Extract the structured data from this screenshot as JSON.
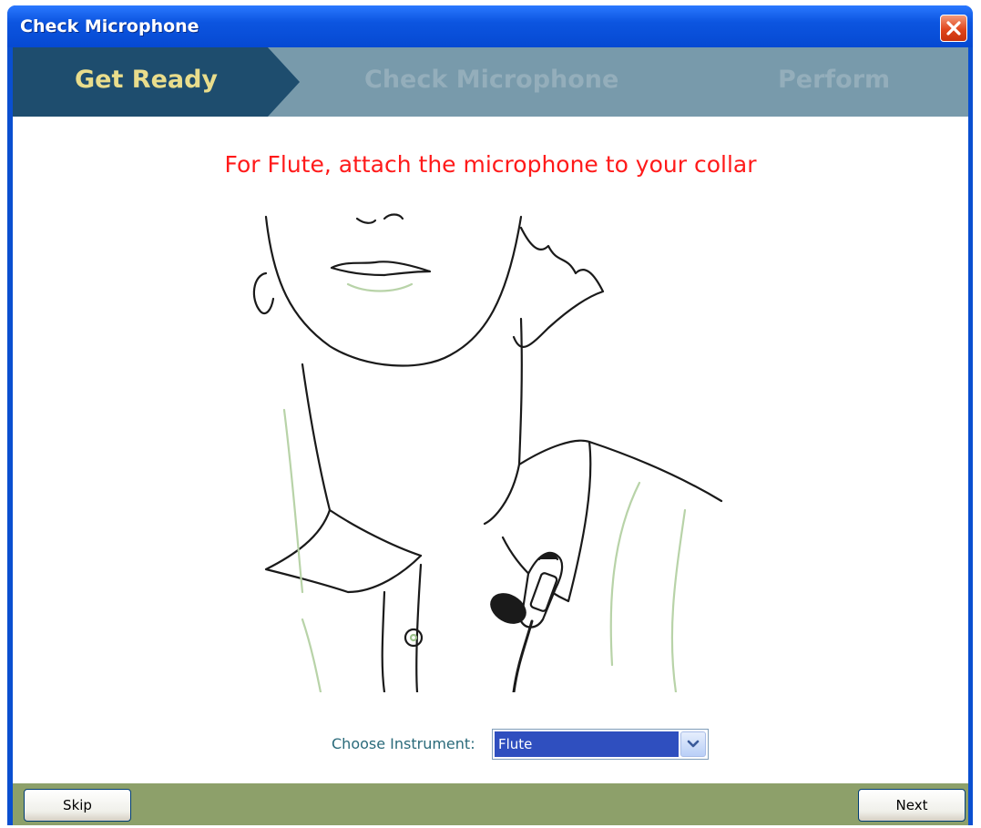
{
  "window": {
    "title": "Check Microphone",
    "close_icon": "close-icon"
  },
  "steps": [
    {
      "label": "Get Ready",
      "active": true
    },
    {
      "label": "Check Microphone",
      "active": false
    },
    {
      "label": "Perform",
      "active": false
    }
  ],
  "instruction": "For Flute, attach the microphone to your collar",
  "illustration": {
    "icon": "collar-microphone-illustration"
  },
  "instrument": {
    "label": "Choose Instrument:",
    "selected": "Flute",
    "dropdown_icon": "chevron-down-icon"
  },
  "buttons": {
    "skip": "Skip",
    "next": "Next"
  },
  "colors": {
    "title_bar": "#0c55e0",
    "step_active_bg": "#1e4d6e",
    "step_active_text": "#e9dd8c",
    "step_inactive_bg": "#789aab",
    "step_inactive_text": "#94aebb",
    "instruction": "#ff1a1a",
    "footer": "#8da06a"
  }
}
